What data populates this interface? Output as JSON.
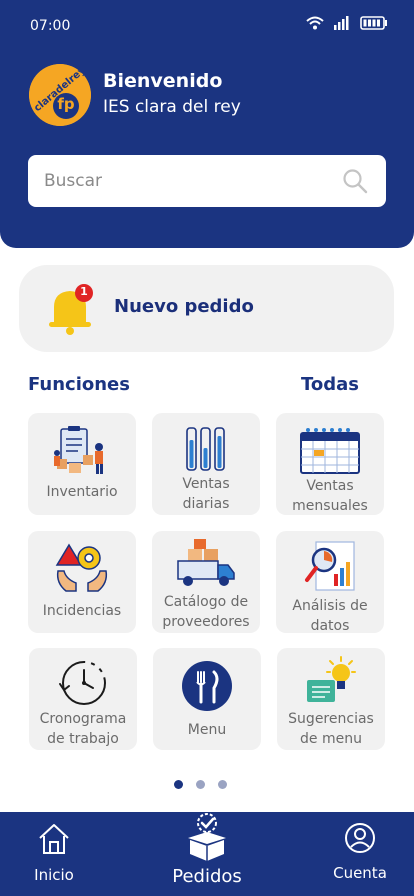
{
  "status_bar": {
    "time": "07:00",
    "icons": [
      "wifi-icon",
      "signal-icon",
      "battery-icon"
    ]
  },
  "header": {
    "welcome": "Bienvenido",
    "school": "IES clara del rey",
    "logo": {
      "text": "claradelrey",
      "badge": "fp"
    }
  },
  "search": {
    "placeholder": "Buscar",
    "value": ""
  },
  "notification": {
    "label": "Nuevo pedido",
    "badge_count": "1"
  },
  "functions": {
    "title": "Funciones",
    "all_label": "Todas",
    "tiles": [
      {
        "name": "inventario",
        "line1": "Inventario",
        "line2": ""
      },
      {
        "name": "ventas-diarias",
        "line1": "Ventas",
        "line2": "diarias"
      },
      {
        "name": "ventas-mensuales",
        "line1": "Ventas",
        "line2": "mensuales"
      },
      {
        "name": "incidencias",
        "line1": "Incidencias",
        "line2": ""
      },
      {
        "name": "catalogo-proveedores",
        "line1": "Catálogo de",
        "line2": "proveedores"
      },
      {
        "name": "analisis-datos",
        "line1": "Análisis de",
        "line2": "datos"
      },
      {
        "name": "cronograma",
        "line1": "Cronograma",
        "line2": "de trabajo"
      },
      {
        "name": "menu",
        "line1": "Menu",
        "line2": ""
      },
      {
        "name": "sugerencias",
        "line1": "Sugerencias",
        "line2": "de menu"
      }
    ]
  },
  "pagination": {
    "pages": 3,
    "active": 1
  },
  "bottom_nav": {
    "inicio": "Inicio",
    "pedidos": "Pedidos",
    "cuenta": "Cuenta"
  },
  "colors": {
    "primary": "#1b3481",
    "accent": "#f5a623",
    "badge": "#e02424",
    "tile_bg": "#f1f1f1"
  }
}
